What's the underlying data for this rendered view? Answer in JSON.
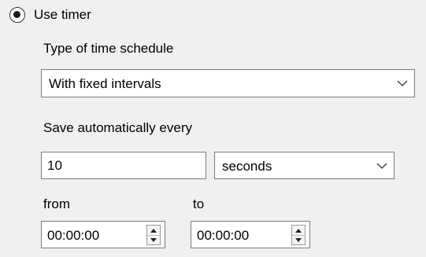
{
  "timer": {
    "radio_label": "Use timer",
    "selected": true
  },
  "schedule": {
    "label": "Type of time schedule",
    "value": "With fixed intervals"
  },
  "autosave": {
    "label": "Save automatically every",
    "interval_value": "10",
    "unit_value": "seconds"
  },
  "range": {
    "from_label": "from",
    "from_value": "00:00:00",
    "to_label": "to",
    "to_value": "00:00:00"
  },
  "icons": {
    "dropdown": "chevron-down-icon",
    "spin_up": "triangle-up-icon",
    "spin_down": "triangle-down-icon"
  }
}
